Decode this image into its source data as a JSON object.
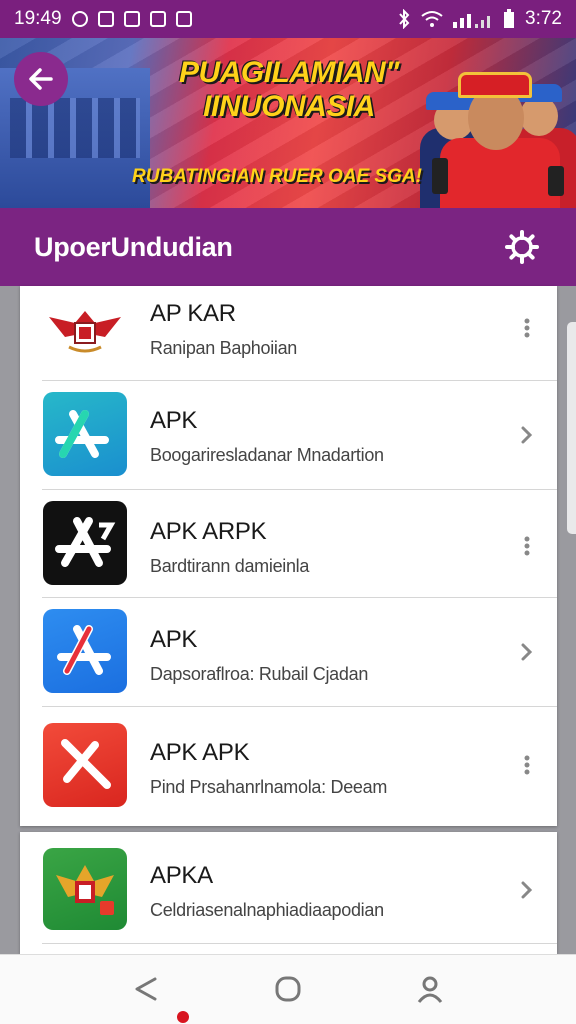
{
  "status_bar": {
    "time": "19:49",
    "battery": "3:72"
  },
  "banner": {
    "title": "PUAGILAMIAN\" IINUONASIA",
    "subtitle": "RUBATINGIAN RUER OAE SGA!"
  },
  "header": {
    "title": "UpoerUndudian"
  },
  "list": [
    {
      "name": "AP KAR",
      "desc": "Ranipan Baphoiian",
      "icon": "garuda-emblem-icon",
      "action": "more-icon"
    },
    {
      "name": "APK",
      "desc": "Boogariresladanar Mnadartion",
      "icon": "app-store-teal-icon",
      "action": "chevron-right-icon"
    },
    {
      "name": "APK ARPK",
      "desc": "Bardtirann damieinla",
      "icon": "app-store-black-icon",
      "action": "more-icon"
    },
    {
      "name": "APK",
      "desc": "Dapsoraflroa: Rubail Cjadan",
      "icon": "app-store-blue-icon",
      "action": "chevron-right-icon"
    },
    {
      "name": "APK APK",
      "desc": "Pind Prsahanrlnamola: Deeam",
      "icon": "app-red-icon",
      "action": "more-icon"
    },
    {
      "name": "APKA",
      "desc": "Celdriasenalnaphiadiaapodian",
      "icon": "garuda-green-icon",
      "action": "chevron-right-icon"
    }
  ],
  "colors": {
    "header": "#7b2482",
    "status_bar": "#7a1f7e",
    "accent_red": "#d8141f"
  }
}
